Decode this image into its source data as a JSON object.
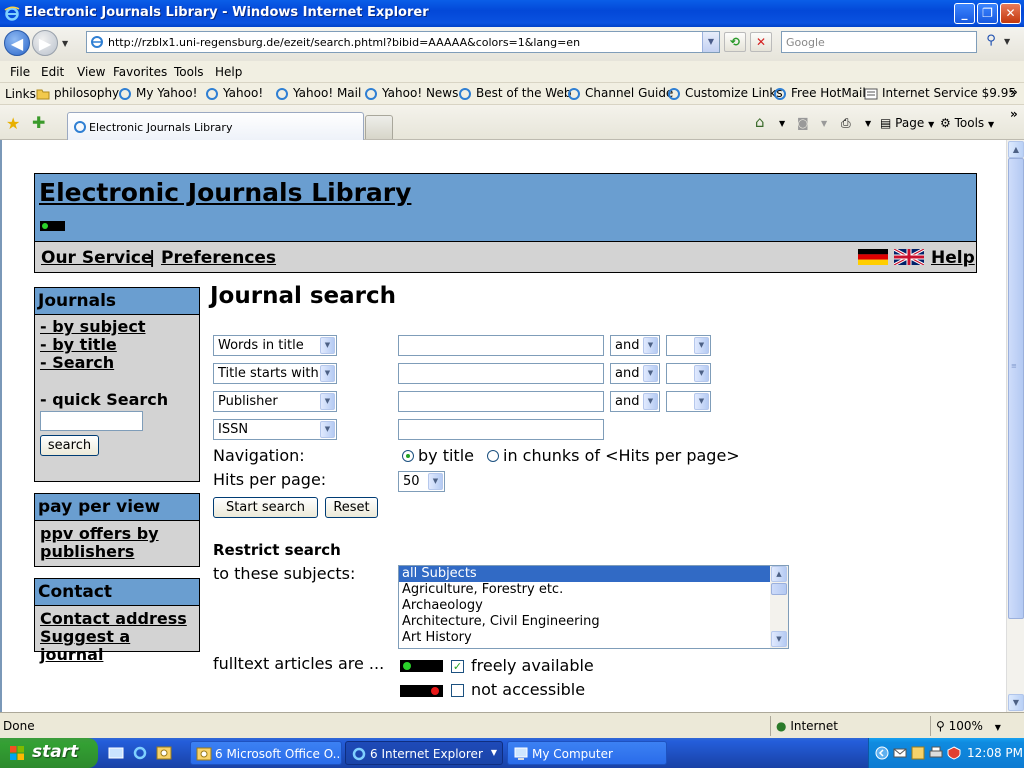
{
  "window": {
    "title": "Electronic Journals Library - Windows Internet Explorer"
  },
  "address_bar": {
    "url": "http://rzblx1.uni-regensburg.de/ezeit/search.phtml?bibid=AAAAA&colors=1&lang=en",
    "search_placeholder": "Google"
  },
  "menu": {
    "items": [
      "File",
      "Edit",
      "View",
      "Favorites",
      "Tools",
      "Help"
    ]
  },
  "links_bar": {
    "label": "Links",
    "items": [
      "philosophy",
      "My Yahoo!",
      "Yahoo!",
      "Yahoo! Mail",
      "Yahoo! News",
      "Best of the Web",
      "Channel Guide",
      "Customize Links",
      "Free HotMail",
      "Internet Service $9.95"
    ]
  },
  "tabs": {
    "active_label": "Electronic Journals Library"
  },
  "command_bar": {
    "page_label": "Page",
    "tools_label": "Tools"
  },
  "site": {
    "title": "Electronic Journals Library",
    "subnav": {
      "service": "Our Service",
      "separator": "|",
      "preferences": "Preferences",
      "help": "Help"
    },
    "sidebar": {
      "journals": {
        "heading": "Journals",
        "links": [
          "- by subject",
          "- by title",
          "- Search"
        ],
        "quick_search_label": "- quick Search",
        "search_button": "search"
      },
      "ppv": {
        "heading": "pay per view",
        "link": "ppv offers by publishers"
      },
      "contact": {
        "heading": "Contact",
        "links": [
          "Contact address",
          "Suggest a journal"
        ]
      }
    },
    "search": {
      "heading": "Journal search",
      "rows": [
        {
          "field": "Words in title",
          "op": "and"
        },
        {
          "field": "Title starts with ...",
          "op": "and"
        },
        {
          "field": "Publisher",
          "op": "and"
        },
        {
          "field": "ISSN"
        }
      ],
      "navigation_label": "Navigation:",
      "navigation_options": [
        "by title",
        "in chunks of <Hits per page>"
      ],
      "hits_label": "Hits per page:",
      "hits_value": "50",
      "start_button": "Start search",
      "reset_button": "Reset",
      "restrict_heading": "Restrict search",
      "subjects_label": "to these subjects:",
      "subjects": [
        "all Subjects",
        "Agriculture, Forestry etc.",
        "Archaeology",
        "Architecture, Civil Engineering",
        "Art History"
      ],
      "fulltext_label": "fulltext articles are ...",
      "fulltext_options": [
        "freely available",
        "not accessible"
      ]
    }
  },
  "status_bar": {
    "status": "Done",
    "zone": "Internet",
    "zoom": "100%"
  },
  "taskbar": {
    "start_label": "start",
    "tasks": [
      "6 Microsoft Office O...",
      "6 Internet Explorer",
      "My Computer"
    ],
    "clock": "12:08 PM"
  },
  "colors": {
    "site_header_blue": "#6a9ed0",
    "site_gray": "#d3d3d3",
    "selected_option": "#316ac5",
    "ampel_green": "#2bd12b",
    "ampel_red": "#e81818"
  }
}
